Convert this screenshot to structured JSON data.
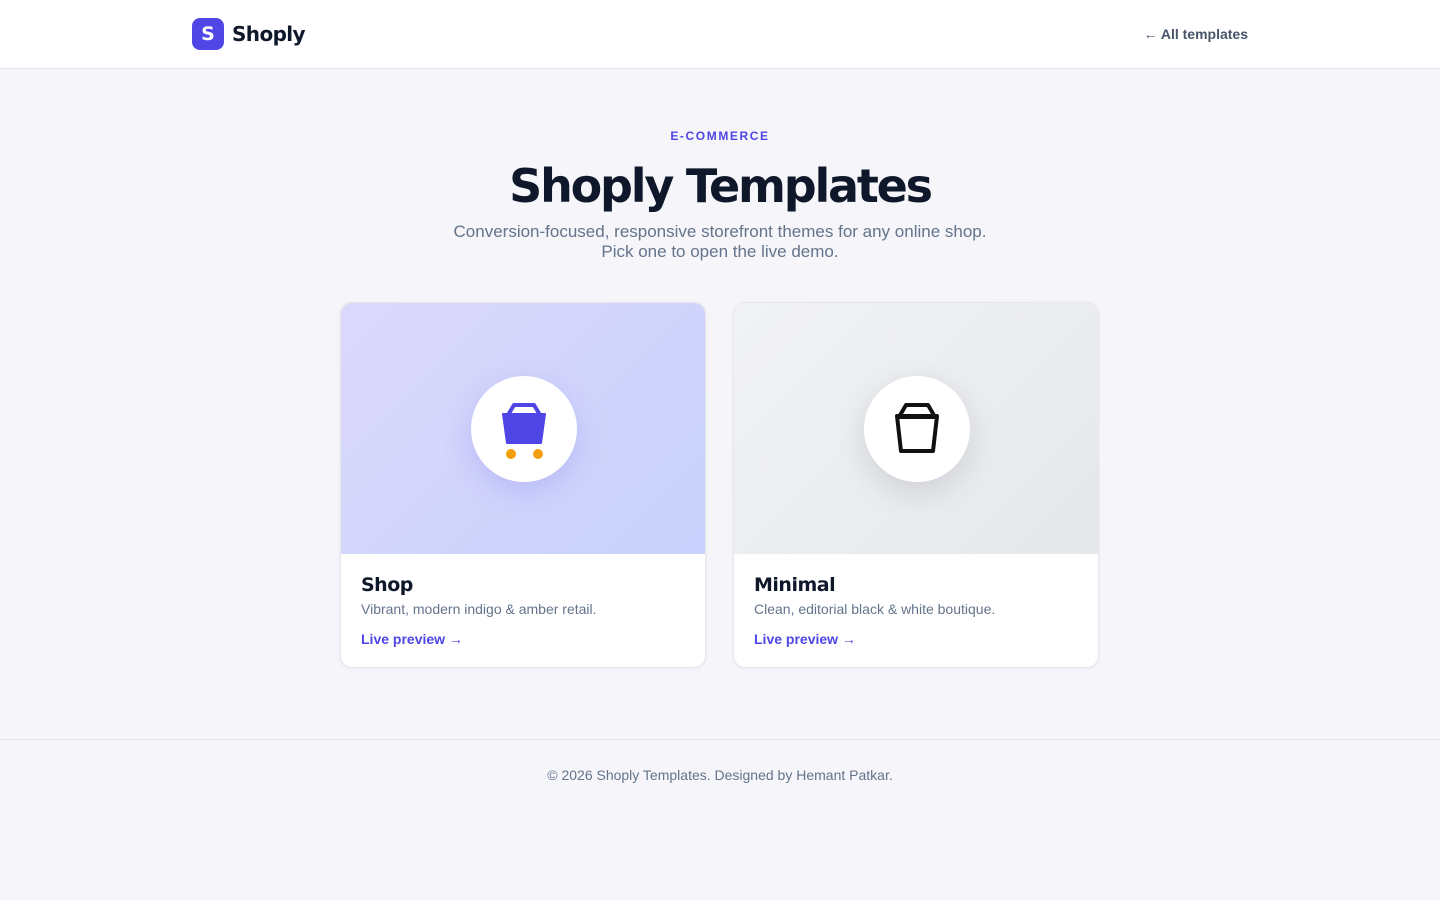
{
  "header": {
    "logo_letter": "S",
    "brand_name": "Shoply",
    "back_link": "← All templates"
  },
  "hero": {
    "eyebrow": "E-COMMERCE",
    "title": "Shoply Templates",
    "subtitle_line1": "Conversion-focused, responsive storefront themes for any online shop.",
    "subtitle_line2": "Pick one to open the live demo."
  },
  "cards": [
    {
      "title": "Shop",
      "description": "Vibrant, modern indigo & amber retail.",
      "link": "Live preview →",
      "icon": "shopping-cart-icon",
      "accent": "#4f46e5",
      "accent_secondary": "#f59e0b"
    },
    {
      "title": "Minimal",
      "description": "Clean, editorial black & white boutique.",
      "link": "Live preview →",
      "icon": "shopping-bag-icon",
      "accent": "#111111"
    }
  ],
  "footer": {
    "text": "© 2026 Shoply Templates. Designed by Hemant Patkar."
  },
  "colors": {
    "brand": "#4f46e5",
    "background": "#f5f5fa",
    "text": "#0f172a",
    "muted": "#64748b"
  }
}
